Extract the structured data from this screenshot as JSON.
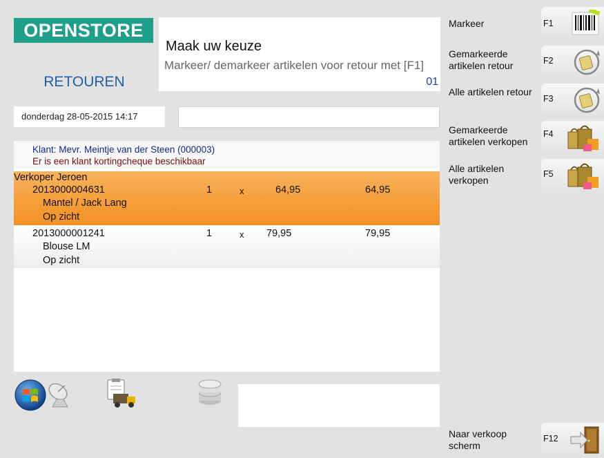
{
  "header": {
    "logo_text": "OPENSTORE",
    "module_title": "RETOUREN"
  },
  "message": {
    "title": "Maak uw keuze",
    "body": "Markeer/ demarkeer artikelen voor retour met [F1]",
    "code": "01"
  },
  "datetime": "donderdag 28-05-2015 14:17",
  "input_value": "",
  "customer": {
    "name": "Klant: Mevr. Meintje van der Steen (000003)",
    "notice": "Er is een klant kortingcheque beschikbaar"
  },
  "list": {
    "seller": "Verkoper Jeroen",
    "rows": [
      {
        "article": "2013000004631",
        "qty": "1",
        "x": "x",
        "price": "64,95",
        "total": "64,95",
        "description": "Mantel / Jack Lang",
        "status": "Op zicht",
        "selected": true
      },
      {
        "article": "2013000001241",
        "qty": "1",
        "x": "x",
        "price": "79,95",
        "total": "79,95",
        "description": "Blouse LM",
        "status": "Op zicht",
        "selected": false
      }
    ]
  },
  "toolbar_icons": [
    "windows-logo-icon",
    "satellite-dish-icon",
    "delivery-truck-icon",
    "database-icon"
  ],
  "function_keys": [
    {
      "label": "Markeer",
      "key": "F1",
      "icon": "barcode-icon"
    },
    {
      "label": "Gemarkeerde artikelen retour",
      "key": "F2",
      "icon": "return-bag-icon"
    },
    {
      "label": "Alle artikelen retour",
      "key": "F3",
      "icon": "return-bag-icon"
    },
    {
      "label": "Gemarkeerde artikelen verkopen",
      "key": "F4",
      "icon": "shopping-bags-icon"
    },
    {
      "label": "Alle artikelen verkopen",
      "key": "F5",
      "icon": "shopping-bags-icon"
    },
    {
      "label": "Naar verkoop scherm",
      "key": "F12",
      "icon": "door-exit-icon"
    }
  ],
  "colors": {
    "background": "#e2e2e2",
    "logo": "#1e9f8a",
    "accent_blue": "#1f5ea8",
    "selected_row": "#f59a32",
    "coupon_text": "#7a1010"
  }
}
